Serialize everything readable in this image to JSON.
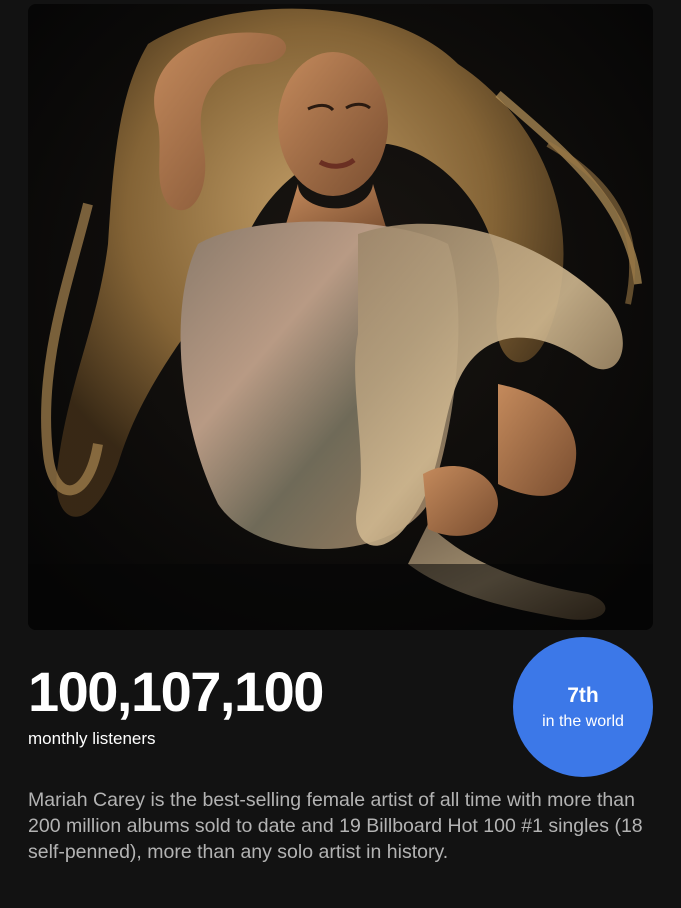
{
  "artist": {
    "name": "Mariah Carey",
    "image_alt": "Mariah Carey"
  },
  "stats": {
    "monthly_listeners": "100,107,100",
    "monthly_listeners_label": "monthly listeners"
  },
  "rank": {
    "value": "7th",
    "label": "in the world",
    "color": "#3c78e8"
  },
  "bio": {
    "text": "Mariah Carey is the best-selling female artist of all time with more than 200 million albums sold to date and 19 Billboard Hot 100 #1 singles (18 self-penned), more than any solo artist in history."
  },
  "colors": {
    "background": "#121212",
    "text_primary": "#ffffff",
    "text_secondary": "#b3b3b3"
  }
}
